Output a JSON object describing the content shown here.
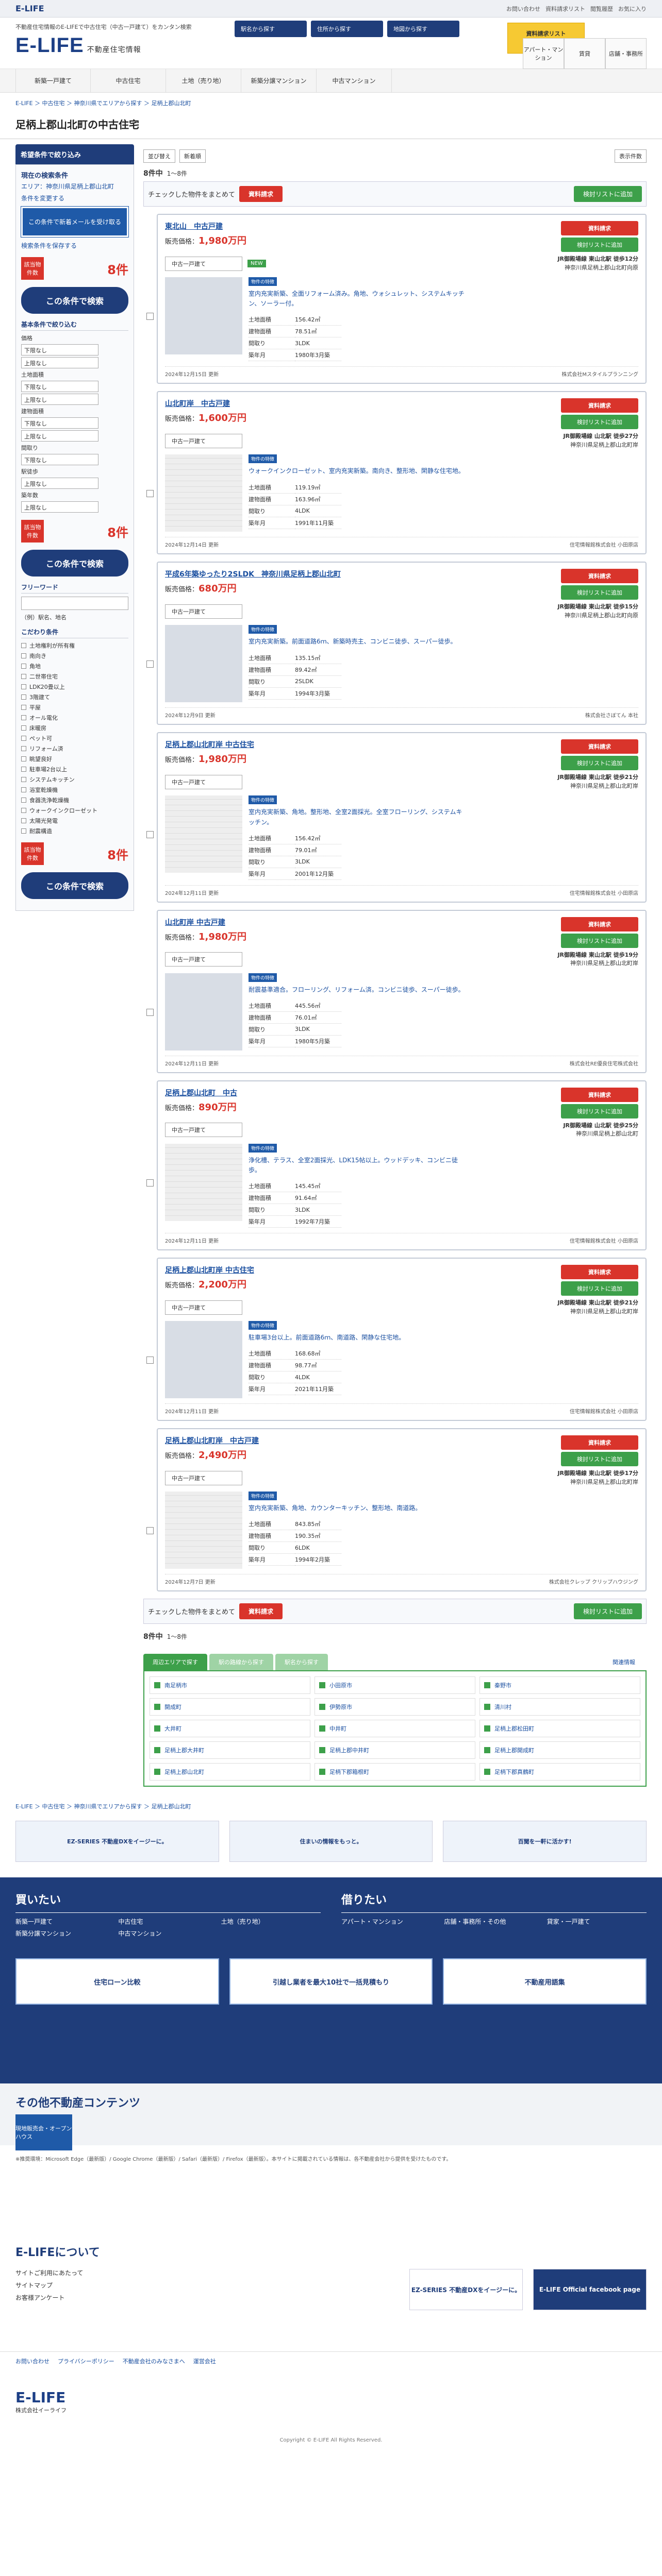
{
  "topbar": {
    "brand": "E-LIFE",
    "links": [
      "お問い合わせ",
      "資料請求リスト",
      "閲覧履歴",
      "お気に入り"
    ]
  },
  "header": {
    "tagline": "不動産住宅情報のE-LIFEで中古住宅（中古一戸建て）をカンタン検索",
    "logo": "E-LIFE",
    "sub": "不動産住宅情報",
    "search_btns": [
      "駅名から探す",
      "住所から探す",
      "地図から探す"
    ],
    "banner": "資料請求リスト",
    "right": [
      "アパート・マンション",
      "賃貸",
      "店舗・事務所"
    ]
  },
  "gnav": [
    "新築一戸建て",
    "中古住宅",
    "土地（売り地）",
    "新築分譲マンション",
    "中古マンション"
  ],
  "breadcrumb": "E-LIFE ＞ 中古住宅 ＞ 神奈川県でエリアから探す ＞ 足柄上郡山北町",
  "page_title": "足柄上郡山北町の中古住宅",
  "sidebar": {
    "head": "希望条件で絞り込み",
    "current": "現在の検索条件",
    "area": "エリア：神奈川県足柄上郡山北町",
    "change": "条件を変更する",
    "mail": "この条件で新着メールを受け取る",
    "mail_btn": "検索条件を保存する",
    "count_label": "該当物件数",
    "count": "8件",
    "search_btn": "この条件で検索",
    "basic": "基本条件で絞り込む",
    "price": "価格",
    "land": "土地面積",
    "bldg": "建物面積",
    "layout": "間取り",
    "walk": "駅徒歩",
    "age": "築年数",
    "sel_low": "下限なし",
    "sel_high": "上限なし",
    "free": "フリーワード",
    "free_hint": "（例）駅名、地名",
    "detail": "こだわり条件",
    "detail2": "設備・構造",
    "checks": [
      "土地権利が所有権",
      "南向き",
      "角地",
      "二世帯住宅",
      "LDK20畳以上",
      "3階建て",
      "平屋",
      "オール電化",
      "床暖房",
      "ペット可",
      "リフォーム済",
      "眺望良好",
      "駐車場2台以上",
      "システムキッチン",
      "浴室乾燥機",
      "食器洗浄乾燥機",
      "ウォークインクローゼット",
      "太陽光発電",
      "耐震構造"
    ]
  },
  "toolbar": {
    "sort": "並び替え",
    "sort_val": "新着順",
    "view": "表示件数"
  },
  "paging": {
    "total": "8件中",
    "range": "1〜8件"
  },
  "allbar": {
    "check": "チェックした物件をまとめて",
    "req": "資料請求",
    "fav": "検討リストに追加"
  },
  "cards": [
    {
      "title": "東北山　中古戸建",
      "price": "1,980万円",
      "type": "中古一戸建て",
      "new": "NEW",
      "station": "JR御殿場線 東山北駅 徒歩12分",
      "addr": "神奈川県足柄上郡山北町向原",
      "points": "室内充実新築、全面リフォーム済み。角地、ウォシュレット、システムキッチン、ソーラー付。",
      "land": "156.42㎡",
      "bldg": "78.51㎡",
      "layout": "3LDK",
      "built": "1980年3月築",
      "date": "2024年12月15日 更新",
      "agent": "株式会社Mスタイルプランニング"
    },
    {
      "title": "山北町岸　中古戸建",
      "price": "1,600万円",
      "type": "中古一戸建て",
      "station": "JR御殿場線 山北駅 徒歩27分",
      "addr": "神奈川県足柄上郡山北町岸",
      "points": "ウォークインクローゼット、室内充実新築。南向き、整形地、閑静な住宅地。",
      "land": "119.19㎡",
      "bldg": "163.96㎡",
      "layout": "4LDK",
      "built": "1991年11月築",
      "date": "2024年12月14日 更新",
      "agent": "住宅情報館株式会社 小田原店"
    },
    {
      "title": "平成6年築ゆったり2SLDK　神奈川県足柄上郡山北町",
      "price": "680万円",
      "type": "中古一戸建て",
      "station": "JR御殿場線 東山北駅 徒歩15分",
      "addr": "神奈川県足柄上郡山北町向原",
      "points": "室内充実新築。前面道路6ｍ、新築時売主、コンビニ徒歩、スーパー徒歩。",
      "land": "135.15㎡",
      "bldg": "89.42㎡",
      "layout": "2SLDK",
      "built": "1994年3月築",
      "date": "2024年12月9日 更新",
      "agent": "株式会社さぼてん 本社"
    },
    {
      "title": "足柄上郡山北町岸 中古住宅",
      "price": "1,980万円",
      "type": "中古一戸建て",
      "station": "JR御殿場線 東山北駅 徒歩21分",
      "addr": "神奈川県足柄上郡山北町岸",
      "points": "室内充実新築、角地。整形地、全室2面採光。全室フローリング、システムキッチン。",
      "land": "156.42㎡",
      "bldg": "79.01㎡",
      "layout": "3LDK",
      "built": "2001年12月築",
      "date": "2024年12月11日 更新",
      "agent": "住宅情報館株式会社 小田原店"
    },
    {
      "title": "山北町岸 中古戸建",
      "price": "1,980万円",
      "type": "中古一戸建て",
      "station": "JR御殿場線 東山北駅 徒歩19分",
      "addr": "神奈川県足柄上郡山北町岸",
      "points": "耐震基準適合。フローリング、リフォーム済。コンビニ徒歩、スーパー徒歩。",
      "land": "445.56㎡",
      "bldg": "76.01㎡",
      "layout": "3LDK",
      "built": "1980年5月築",
      "date": "2024年12月11日 更新",
      "agent": "株式会社RE優良住宅株式会社"
    },
    {
      "title": "足柄上郡山北町　中古",
      "price": "890万円",
      "type": "中古一戸建て",
      "station": "JR御殿場線 山北駅 徒歩25分",
      "addr": "神奈川県足柄上郡山北町",
      "points": "浄化槽、テラス、全室2面採光、LDK15帖以上。ウッドデッキ、コンビニ徒歩。",
      "land": "145.45㎡",
      "bldg": "91.64㎡",
      "layout": "3LDK",
      "built": "1992年7月築",
      "date": "2024年12月11日 更新",
      "agent": "住宅情報館株式会社 小田原店"
    },
    {
      "title": "足柄上郡山北町岸 中古住宅",
      "price": "2,200万円",
      "type": "中古一戸建て",
      "station": "JR御殿場線 東山北駅 徒歩21分",
      "addr": "神奈川県足柄上郡山北町岸",
      "points": "駐車場3台以上。前面道路6ｍ、南道路、閑静な住宅地。",
      "land": "168.68㎡",
      "bldg": "98.77㎡",
      "layout": "4LDK",
      "built": "2021年11月築",
      "date": "2024年12月11日 更新",
      "agent": "住宅情報館株式会社 小田原店"
    },
    {
      "title": "足柄上郡山北町岸　中古戸建",
      "price": "2,490万円",
      "type": "中古一戸建て",
      "station": "JR御殿場線 東山北駅 徒歩17分",
      "addr": "神奈川県足柄上郡山北町岸",
      "points": "室内充実新築、角地、カウンターキッチン、整形地、南道路。",
      "land": "843.85㎡",
      "bldg": "190.35㎡",
      "layout": "6LDK",
      "built": "1994年2月築",
      "date": "2024年12月7日 更新",
      "agent": "株式会社クレップ クリップハウジング"
    }
  ],
  "labels": {
    "req": "資料請求",
    "fav": "検討リストに追加",
    "land": "土地面積",
    "bldg": "建物面積",
    "layout": "間取り",
    "built": "築年月",
    "price": "販売価格：",
    "badge": "物件の特徴"
  },
  "ctabs": {
    "t1": "周辺エリアで探す",
    "t2": "駅の路線から探す",
    "t3": "駅名から探す",
    "ex": "関連情報"
  },
  "cities": [
    "南足柄市",
    "小田原市",
    "秦野市",
    "開成町",
    "伊勢原市",
    "清川村",
    "大井町",
    "中井町",
    "足柄上郡松田町",
    "足柄上郡大井町",
    "足柄上郡中井町",
    "足柄上郡開成町",
    "足柄上郡山北町",
    "足柄下郡箱根町",
    "足柄下郡真鶴町"
  ],
  "bottom_bc": "E-LIFE ＞ 中古住宅 ＞ 神奈川県でエリアから探す ＞ 足柄上郡山北町",
  "ads": [
    "EZ-SERIES 不動産DXをイージーに。",
    "住まいの情報をもっと。",
    "百聞を一軒に活かす!"
  ],
  "blue": {
    "buy": "買いたい",
    "rent": "借りたい",
    "buy_links": [
      "新築一戸建て",
      "中古住宅",
      "土地（売り地）",
      "新築分譲マンション",
      "中古マンション"
    ],
    "rent_links": [
      "アパート・マンション",
      "店舗・事務所・その他",
      "貸家・一戸建て"
    ],
    "b1": "住宅ローン比較",
    "b2": "引越し業者を最大10社で一括見積もり",
    "b3": "不動産用語集"
  },
  "other": {
    "title": "その他不動産コンテンツ",
    "tag": "不動産情報",
    "cube": "現地販売会・オープンハウス"
  },
  "notice": "※推奨環境：Microsoft Edge（最新版）/ Google Chrome（最新版）/ Safari（最新版）/ Firefox（最新版）。本サイトに掲載されている情報は、各不動産会社から提供を受けたものです。",
  "about": {
    "title": "E-LIFEについて",
    "links": [
      "サイトご利用にあたって",
      "サイトマップ",
      "お客様アンケート"
    ],
    "b1": "EZ-SERIES 不動産DXをイージーに。",
    "b2": "E-LIFE Official facebook page"
  },
  "flinks": [
    "お問い合わせ",
    "プライバシーポリシー",
    "不動産会社のみなさまへ",
    "運営会社"
  ],
  "footer": {
    "logo": "E-LIFE",
    "sub": "株式会社イーライフ",
    "copy": "Copyright © E-LIFE All Rights Reserved."
  }
}
